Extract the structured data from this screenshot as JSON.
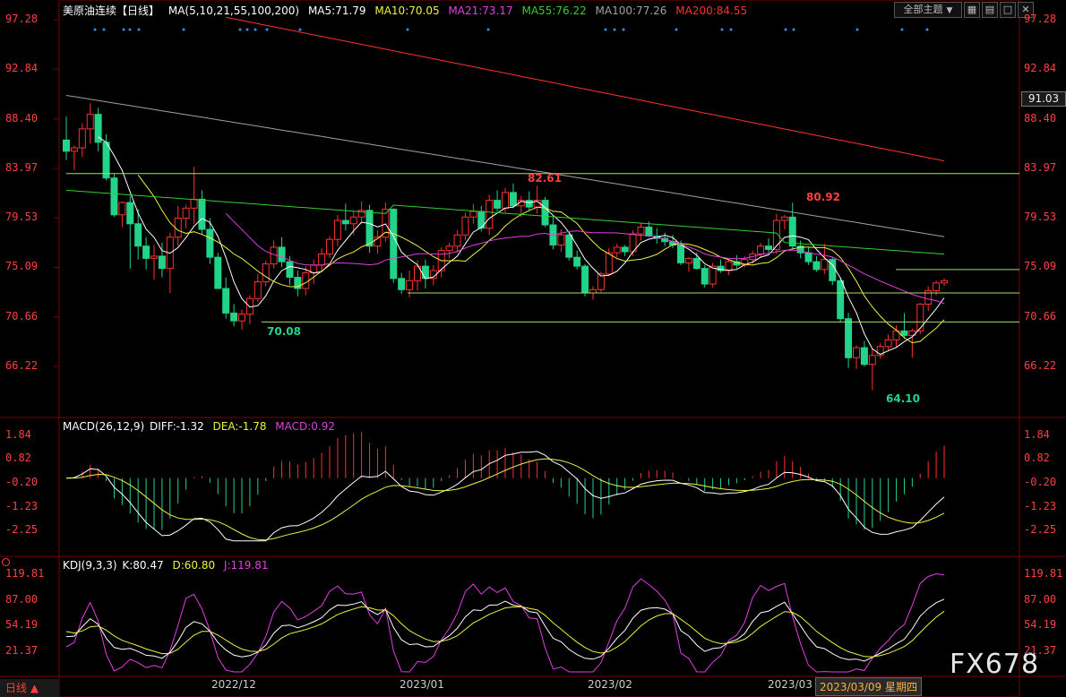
{
  "header": {
    "title": "美原油连续",
    "period": "【日线】",
    "ma_label": "MA(5,10,21,55,100,200)",
    "ma5": "MA5:71.79",
    "ma10": "MA10:70.05",
    "ma21": "MA21:73.17",
    "ma55": "MA55:76.22",
    "ma100": "MA100:77.26",
    "ma200": "MA200:84.55"
  },
  "toolbar": {
    "theme_select": "全部主题",
    "theme_arrow": "▼"
  },
  "colors": {
    "ma5": "#ffffff",
    "ma10": "#f0f040",
    "ma21": "#e040e0",
    "ma55": "#30d030",
    "ma100": "#a0a0a0",
    "ma200": "#ff3030",
    "up": "#ff3030",
    "down": "#22d38a"
  },
  "price_axis": {
    "ticks": [
      "97.28",
      "92.84",
      "88.40",
      "83.97",
      "79.53",
      "75.09",
      "70.66",
      "66.22"
    ],
    "current": "91.03"
  },
  "annotations": {
    "high1": "82.61",
    "high2": "80.92",
    "low1": "70.08",
    "low2": "64.10"
  },
  "macd": {
    "label": "MACD(26,12,9)",
    "diff": "DIFF:-1.32",
    "dea": "DEA:-1.78",
    "macd": "MACD:0.92",
    "ticks": [
      "1.84",
      "0.82",
      "-0.20",
      "-1.23",
      "-2.25"
    ]
  },
  "kdj": {
    "label": "KDJ(9,3,3)",
    "k": "K:80.47",
    "d": "D:60.80",
    "j": "J:119.81",
    "ticks": [
      "119.81",
      "87.00",
      "54.19",
      "21.37"
    ]
  },
  "x_axis": {
    "labels": [
      "2022/12",
      "2023/01",
      "2023/02",
      "2023/03"
    ],
    "cursor_date": "2023/03/09 星期四"
  },
  "footer": {
    "period_select": "日线 ▲"
  },
  "watermark": "FX678",
  "chart_data": {
    "type": "candlestick",
    "title": "美原油连续",
    "ylim": [
      64,
      97.5
    ],
    "candles": [
      [
        86.5,
        88.6,
        84.7,
        85.5
      ],
      [
        85.5,
        86.0,
        83.8,
        85.8
      ],
      [
        85.8,
        88.0,
        85.0,
        87.5
      ],
      [
        87.5,
        89.8,
        86.2,
        88.8
      ],
      [
        88.8,
        89.4,
        85.5,
        86.3
      ],
      [
        86.3,
        87.0,
        82.9,
        83.1
      ],
      [
        83.1,
        83.5,
        79.6,
        79.8
      ],
      [
        79.8,
        81.0,
        78.7,
        80.9
      ],
      [
        80.9,
        81.5,
        75.0,
        79.0
      ],
      [
        79.0,
        80.3,
        75.8,
        77.0
      ],
      [
        77.0,
        77.8,
        74.9,
        75.9
      ],
      [
        75.9,
        77.1,
        74.0,
        76.1
      ],
      [
        76.1,
        77.3,
        74.2,
        75.0
      ],
      [
        75.0,
        78.2,
        72.8,
        77.8
      ],
      [
        77.8,
        80.6,
        77.0,
        79.5
      ],
      [
        79.5,
        80.7,
        78.6,
        80.4
      ],
      [
        80.4,
        84.1,
        79.0,
        81.2
      ],
      [
        81.2,
        82.0,
        78.0,
        78.5
      ],
      [
        78.5,
        79.5,
        75.4,
        76.0
      ],
      [
        76.0,
        76.4,
        73.3,
        73.2
      ],
      [
        73.2,
        74.2,
        70.5,
        71.0
      ],
      [
        71.0,
        71.8,
        69.8,
        70.3
      ],
      [
        70.3,
        71.3,
        69.5,
        70.9
      ],
      [
        70.9,
        72.6,
        70.0,
        72.3
      ],
      [
        72.3,
        74.5,
        72.0,
        73.8
      ],
      [
        73.8,
        75.7,
        73.4,
        75.4
      ],
      [
        75.4,
        77.5,
        75.0,
        76.9
      ],
      [
        76.9,
        77.8,
        75.1,
        75.6
      ],
      [
        75.6,
        76.1,
        73.5,
        74.2
      ],
      [
        74.2,
        74.8,
        72.5,
        73.2
      ],
      [
        73.2,
        75.2,
        72.6,
        74.6
      ],
      [
        74.6,
        75.8,
        73.6,
        75.3
      ],
      [
        75.3,
        76.8,
        74.8,
        76.3
      ],
      [
        76.3,
        77.9,
        75.9,
        77.6
      ],
      [
        77.6,
        79.8,
        77.0,
        79.3
      ],
      [
        79.3,
        80.8,
        78.4,
        79.0
      ],
      [
        79.0,
        80.1,
        78.0,
        79.6
      ],
      [
        79.6,
        81.0,
        79.0,
        80.2
      ],
      [
        80.2,
        80.7,
        76.4,
        77.0
      ],
      [
        77.0,
        78.4,
        76.3,
        77.8
      ],
      [
        77.8,
        80.9,
        77.4,
        80.3
      ],
      [
        80.3,
        80.4,
        73.7,
        74.1
      ],
      [
        74.1,
        74.6,
        72.7,
        73.1
      ],
      [
        73.1,
        74.8,
        72.4,
        73.9
      ],
      [
        73.9,
        75.7,
        73.0,
        75.2
      ],
      [
        75.2,
        75.8,
        73.2,
        74.1
      ],
      [
        74.1,
        75.3,
        73.5,
        74.8
      ],
      [
        74.8,
        76.9,
        74.2,
        76.6
      ],
      [
        76.6,
        77.3,
        75.9,
        77.0
      ],
      [
        77.0,
        78.4,
        76.4,
        78.0
      ],
      [
        78.0,
        80.0,
        77.5,
        79.6
      ],
      [
        79.6,
        80.8,
        79.0,
        80.1
      ],
      [
        80.1,
        80.6,
        78.3,
        78.6
      ],
      [
        78.6,
        81.6,
        78.0,
        81.1
      ],
      [
        81.1,
        82.0,
        80.1,
        80.4
      ],
      [
        80.4,
        82.2,
        80.0,
        81.8
      ],
      [
        81.8,
        82.6,
        80.4,
        80.6
      ],
      [
        80.6,
        81.5,
        79.6,
        81.1
      ],
      [
        81.1,
        81.9,
        80.2,
        80.5
      ],
      [
        80.5,
        82.4,
        79.9,
        81.1
      ],
      [
        81.1,
        81.4,
        78.7,
        78.9
      ],
      [
        78.9,
        79.6,
        76.7,
        77.1
      ],
      [
        77.1,
        78.5,
        76.5,
        78.0
      ],
      [
        78.0,
        78.3,
        75.7,
        76.0
      ],
      [
        76.0,
        76.6,
        74.9,
        75.2
      ],
      [
        75.2,
        75.4,
        72.5,
        72.8
      ],
      [
        72.8,
        73.4,
        72.2,
        73.1
      ],
      [
        73.1,
        74.7,
        72.9,
        74.5
      ],
      [
        74.5,
        76.8,
        74.3,
        76.4
      ],
      [
        76.4,
        77.2,
        76.0,
        76.9
      ],
      [
        76.9,
        77.1,
        76.1,
        76.5
      ],
      [
        76.5,
        78.4,
        76.1,
        78.1
      ],
      [
        78.1,
        79.1,
        77.5,
        78.7
      ],
      [
        78.7,
        79.2,
        77.8,
        77.9
      ],
      [
        77.9,
        78.6,
        77.2,
        77.7
      ],
      [
        77.7,
        78.2,
        77.0,
        77.4
      ],
      [
        77.4,
        78.0,
        76.8,
        77.1
      ],
      [
        77.1,
        77.5,
        75.3,
        75.5
      ],
      [
        75.5,
        76.0,
        74.7,
        75.9
      ],
      [
        75.9,
        76.4,
        74.9,
        75.0
      ],
      [
        75.0,
        75.3,
        73.3,
        73.6
      ],
      [
        73.6,
        75.5,
        73.3,
        75.2
      ],
      [
        75.2,
        75.8,
        74.6,
        74.8
      ],
      [
        74.8,
        75.8,
        74.4,
        75.6
      ],
      [
        75.6,
        76.2,
        75.0,
        75.3
      ],
      [
        75.3,
        76.1,
        75.1,
        75.8
      ],
      [
        75.8,
        76.6,
        75.4,
        76.3
      ],
      [
        76.3,
        77.3,
        76.0,
        77.0
      ],
      [
        77.0,
        77.7,
        76.4,
        76.7
      ],
      [
        76.7,
        79.9,
        76.3,
        79.3
      ],
      [
        79.3,
        79.8,
        78.5,
        79.6
      ],
      [
        79.6,
        80.9,
        76.8,
        77.0
      ],
      [
        77.0,
        77.5,
        75.9,
        76.4
      ],
      [
        76.4,
        76.9,
        75.3,
        75.6
      ],
      [
        75.6,
        76.1,
        74.7,
        74.9
      ],
      [
        74.9,
        77.2,
        74.5,
        75.8
      ],
      [
        75.8,
        76.0,
        73.5,
        73.9
      ],
      [
        73.9,
        74.2,
        70.2,
        70.5
      ],
      [
        70.5,
        71.0,
        66.1,
        67.0
      ],
      [
        67.0,
        68.1,
        66.0,
        67.9
      ],
      [
        67.9,
        68.5,
        66.2,
        66.4
      ],
      [
        66.4,
        67.8,
        64.1,
        67.2
      ],
      [
        67.2,
        68.3,
        66.9,
        68.0
      ],
      [
        68.0,
        69.1,
        67.6,
        68.6
      ],
      [
        68.6,
        69.9,
        68.0,
        69.4
      ],
      [
        69.4,
        71.0,
        68.7,
        69.0
      ],
      [
        69.0,
        69.6,
        67.0,
        69.4
      ],
      [
        69.4,
        71.9,
        69.1,
        71.8
      ],
      [
        71.8,
        73.4,
        71.2,
        73.0
      ],
      [
        73.0,
        73.9,
        72.6,
        73.7
      ],
      [
        73.7,
        74.1,
        73.4,
        73.9
      ]
    ],
    "hlines": [
      83.5,
      74.9,
      72.8,
      70.2
    ]
  }
}
